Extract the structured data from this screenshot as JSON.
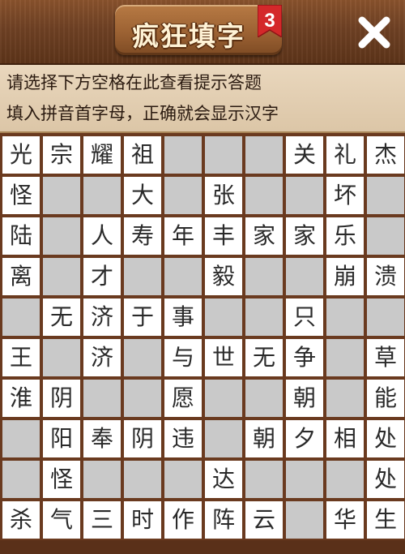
{
  "header": {
    "title": "疯狂填字",
    "level": "3",
    "close_label": "✕"
  },
  "hint": {
    "line1": "请选择下方空格在此查看提示答题",
    "line2": "填入拼音首字母，正确就会显示汉字"
  },
  "colors": {
    "wood": "#6a3a1f",
    "hint_bg": "#e3cfb2",
    "cell_filled": "#ffffff",
    "cell_empty": "#c9c9c9",
    "badge_red": "#d4282a"
  },
  "grid": {
    "rows": [
      [
        "光",
        "宗",
        "耀",
        "祖",
        "",
        "",
        "",
        "关",
        "礼",
        "杰"
      ],
      [
        "怪",
        "",
        "",
        "大",
        "",
        "张",
        "",
        "",
        "坏",
        ""
      ],
      [
        "陆",
        "",
        "人",
        "寿",
        "年",
        "丰",
        "家",
        "家",
        "乐",
        ""
      ],
      [
        "离",
        "",
        "才",
        "",
        "",
        "毅",
        "",
        "",
        "崩",
        "溃"
      ],
      [
        "",
        "无",
        "济",
        "于",
        "事",
        "",
        "",
        "只",
        "",
        ""
      ],
      [
        "王",
        "",
        "济",
        "",
        "与",
        "世",
        "无",
        "争",
        "",
        "草"
      ],
      [
        "淮",
        "阴",
        "",
        "",
        "愿",
        "",
        "",
        "朝",
        "",
        "能"
      ],
      [
        "",
        "阳",
        "奉",
        "阴",
        "违",
        "",
        "朝",
        "夕",
        "相",
        "处"
      ],
      [
        "",
        "怪",
        "",
        "",
        "",
        "达",
        "",
        "",
        "",
        "处"
      ],
      [
        "杀",
        "气",
        "三",
        "时",
        "作",
        "阵",
        "云",
        "",
        "华",
        "生"
      ]
    ]
  }
}
